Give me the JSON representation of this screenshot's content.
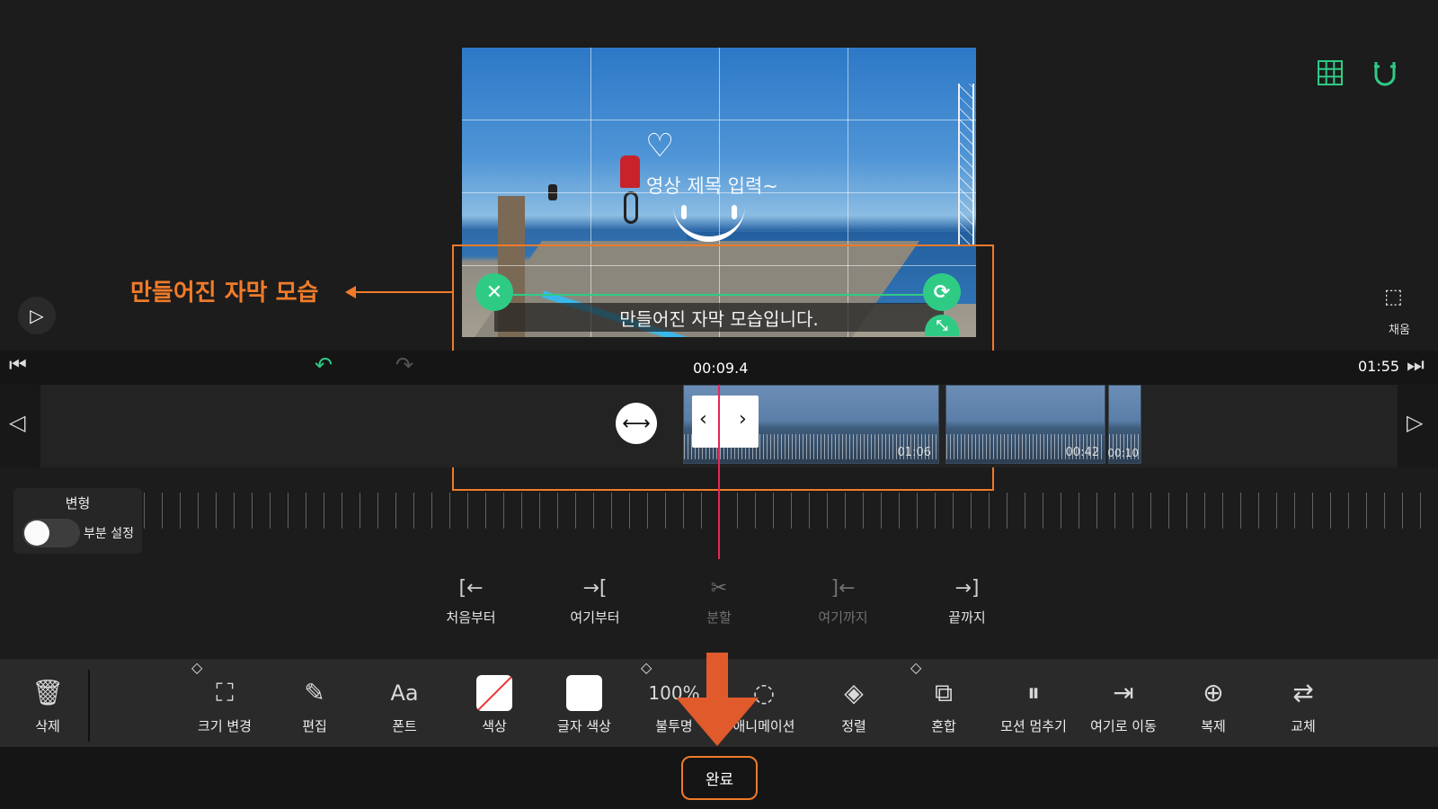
{
  "preview": {
    "title_text": "영상 제목 입력~",
    "subtitle_text": "만들어진 자막 모습입니다."
  },
  "annotation": {
    "callout": "만들어진 자막 모습",
    "accent": "#f07b2a"
  },
  "right_panel": {
    "fill_label": "채움"
  },
  "timeline": {
    "current_time": "00:09.4",
    "total_time": "01:55",
    "clips": [
      {
        "label": "01:06"
      },
      {
        "label": "00:42"
      },
      {
        "label": "00:10"
      }
    ],
    "playhead_color": "#e8265a"
  },
  "transform_panel": {
    "title": "변형",
    "toggle_label": "부분 설정"
  },
  "trim": [
    {
      "label": "처음부터",
      "icon": "trim-from-start-icon",
      "glyph": "[←"
    },
    {
      "label": "여기부터",
      "icon": "trim-from-here-icon",
      "glyph": "→["
    },
    {
      "label": "분할",
      "icon": "split-scissors-icon",
      "glyph": "✂"
    },
    {
      "label": "여기까지",
      "icon": "trim-to-here-icon",
      "glyph": "]←"
    },
    {
      "label": "끝까지",
      "icon": "trim-to-end-icon",
      "glyph": "→]"
    }
  ],
  "toolbar": {
    "delete_label": "삭제",
    "tools": [
      {
        "label": "크기 변경",
        "icon": "crop-icon",
        "glyph": "⛶"
      },
      {
        "label": "편집",
        "icon": "pencil-icon",
        "glyph": "✎"
      },
      {
        "label": "폰트",
        "icon": "font-icon",
        "glyph": "Aa"
      },
      {
        "label": "색상",
        "icon": "color-swatch-icon",
        "glyph": ""
      },
      {
        "label": "글자 색상",
        "icon": "text-color-swatch-icon",
        "glyph": ""
      },
      {
        "label": "불투명",
        "icon": "opacity-icon",
        "glyph": "100%"
      },
      {
        "label": "애니메이션",
        "icon": "animation-icon",
        "glyph": "◌"
      },
      {
        "label": "정렬",
        "icon": "layers-icon",
        "glyph": "◈"
      },
      {
        "label": "혼합",
        "icon": "blend-icon",
        "glyph": "⧉"
      },
      {
        "label": "모션 멈추기",
        "icon": "pause-motion-icon",
        "glyph": "⏸"
      },
      {
        "label": "여기로 이동",
        "icon": "move-here-icon",
        "glyph": "⇥"
      },
      {
        "label": "복제",
        "icon": "duplicate-icon",
        "glyph": "⊕"
      },
      {
        "label": "교체",
        "icon": "replace-icon",
        "glyph": "⇄"
      }
    ]
  },
  "done_label": "완료",
  "colors": {
    "green": "#2fcb85",
    "orange": "#f07b2a"
  }
}
